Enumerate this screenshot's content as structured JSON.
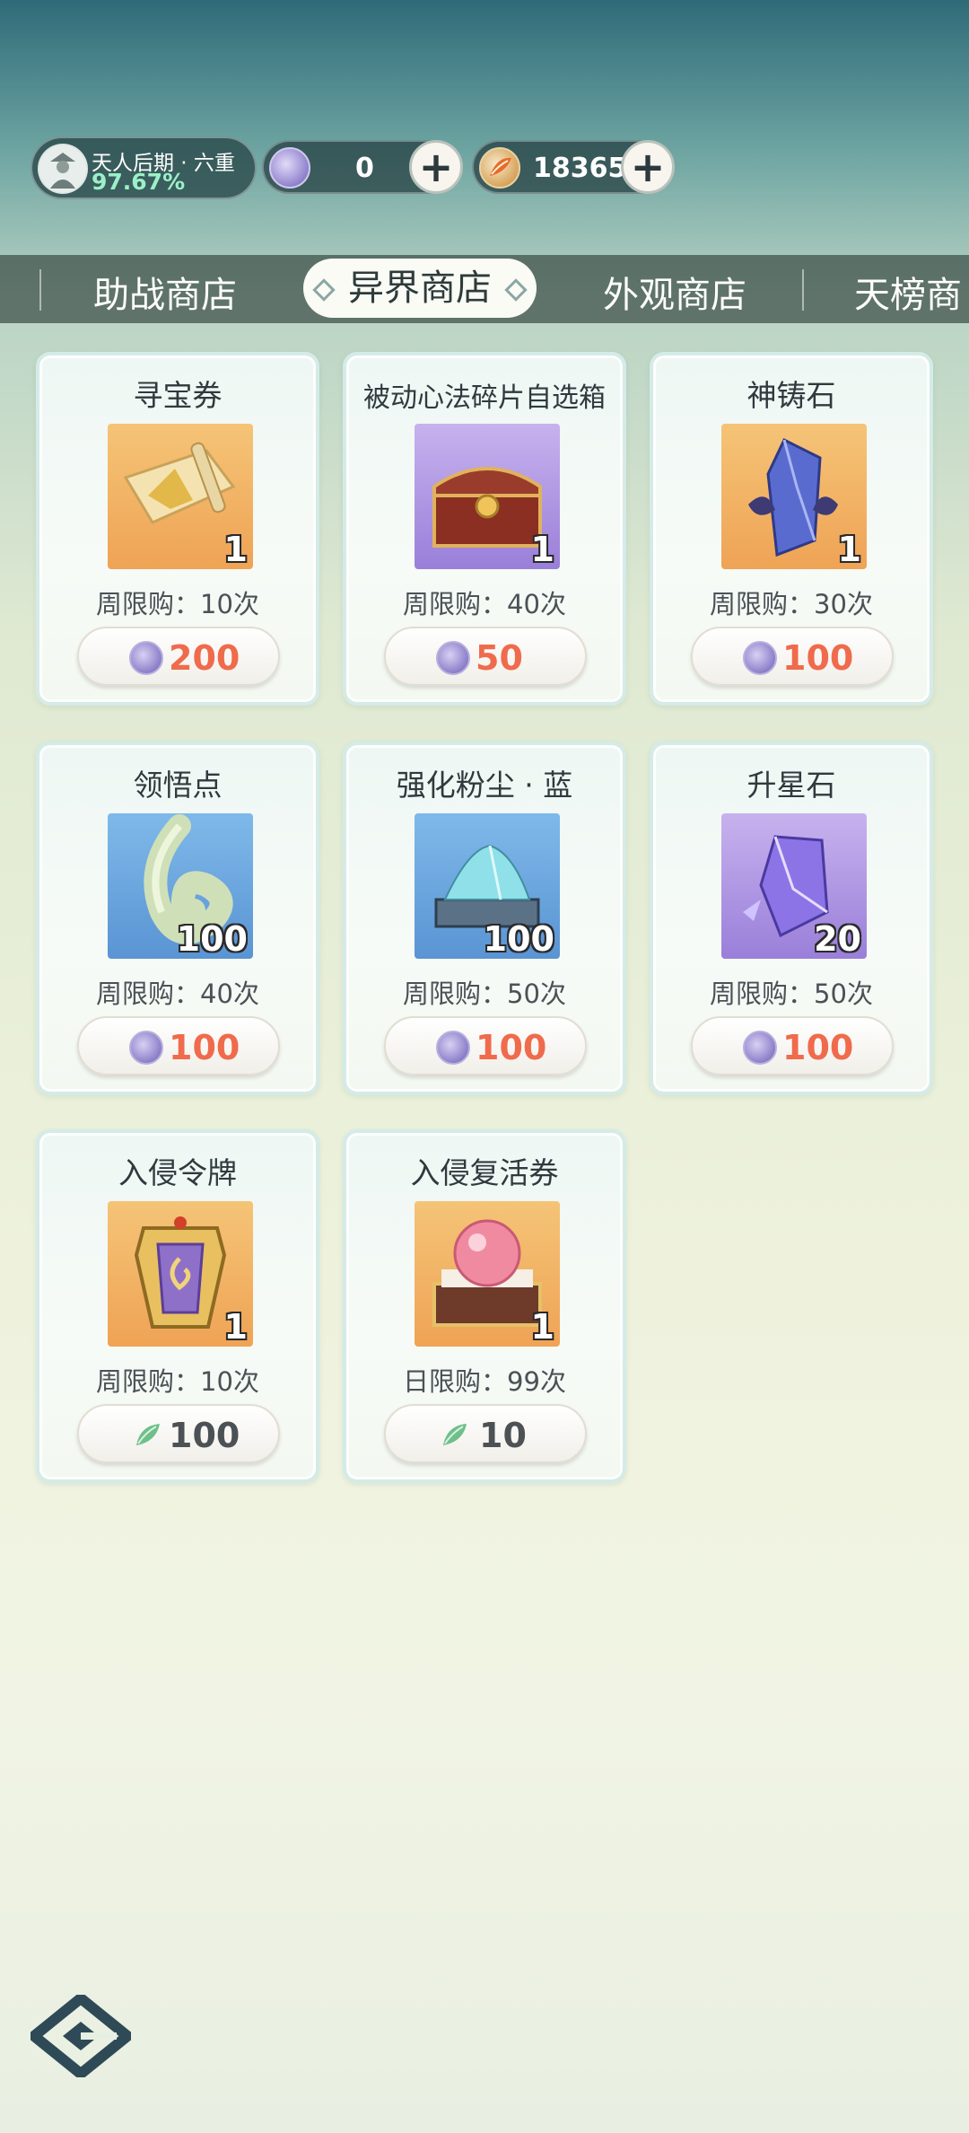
{
  "header": {
    "realm_title": "天人后期 · 六重",
    "realm_progress": "97.67%",
    "currency_1": {
      "value": "0",
      "icon": "purple-coin-icon"
    },
    "currency_2": {
      "value": "18365",
      "icon": "leaf-coin-icon"
    }
  },
  "tabs": [
    {
      "label": "助战商店"
    },
    {
      "label": "异界商店",
      "active": true
    },
    {
      "label": "外观商店"
    },
    {
      "label": "天榜商"
    }
  ],
  "items": [
    {
      "name": "寻宝券",
      "qty": "1",
      "limit": "周限购：10次",
      "price": "200",
      "currency": "purple-coin",
      "bg": "orange"
    },
    {
      "name": "被动心法碎片自选箱",
      "qty": "1",
      "limit": "周限购：40次",
      "price": "50",
      "currency": "purple-coin",
      "bg": "purple"
    },
    {
      "name": "神铸石",
      "qty": "1",
      "limit": "周限购：30次",
      "price": "100",
      "currency": "purple-coin",
      "bg": "orange"
    },
    {
      "name": "领悟点",
      "qty": "100",
      "limit": "周限购：40次",
      "price": "100",
      "currency": "purple-coin",
      "bg": "blue"
    },
    {
      "name": "强化粉尘 · 蓝",
      "qty": "100",
      "limit": "周限购：50次",
      "price": "100",
      "currency": "purple-coin",
      "bg": "blue"
    },
    {
      "name": "升星石",
      "qty": "20",
      "limit": "周限购：50次",
      "price": "100",
      "currency": "purple-coin",
      "bg": "purple"
    },
    {
      "name": "入侵令牌",
      "qty": "1",
      "limit": "周限购：10次",
      "price": "100",
      "currency": "leaf-coin",
      "bg": "orange"
    },
    {
      "name": "入侵复活券",
      "qty": "1",
      "limit": "日限购：99次",
      "price": "10",
      "currency": "leaf-coin",
      "bg": "orange"
    }
  ],
  "colors": {
    "price_purple": "#ef6b4c",
    "price_leaf": "#4b5155",
    "tabbar": "#3c4e46"
  }
}
